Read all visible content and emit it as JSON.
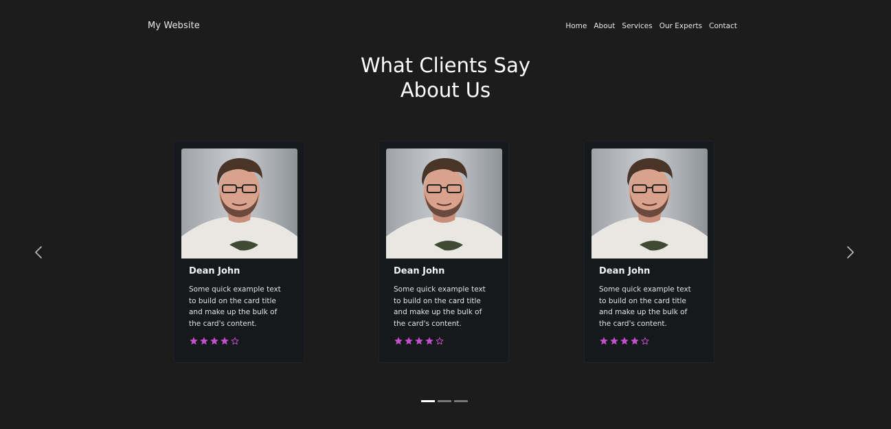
{
  "navbar": {
    "brand": "My Website",
    "links": [
      "Home",
      "About",
      "Services",
      "Our Experts",
      "Contact"
    ]
  },
  "section": {
    "title_line1": "What Clients Say",
    "title_line2": "About Us"
  },
  "carousel": {
    "prev_icon": "chevron-left-icon",
    "next_icon": "chevron-right-icon",
    "active_slide": 1,
    "slide_count": 3
  },
  "cards": [
    {
      "name": "Dean John",
      "text": "Some quick example text to build on the card title and make up the bulk of the card's content.",
      "rating": 4,
      "rating_max": 5
    },
    {
      "name": "Dean John",
      "text": "Some quick example text to build on the card title and make up the bulk of the card's content.",
      "rating": 4,
      "rating_max": 5
    },
    {
      "name": "Dean John",
      "text": "Some quick example text to build on the card title and make up the bulk of the card's content.",
      "rating": 4,
      "rating_max": 5
    }
  ],
  "colors": {
    "background": "#1c1c1c",
    "card_background": "#16191c",
    "star": "#c34fcb",
    "indicator_active": "#ffffff",
    "indicator_inactive": "#777777"
  }
}
